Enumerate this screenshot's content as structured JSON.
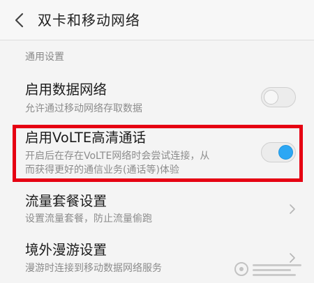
{
  "header": {
    "title": "双卡和移动网络",
    "back_icon": "chevron-left-icon"
  },
  "section": {
    "label": "通用设置"
  },
  "items": [
    {
      "title": "启用数据网络",
      "subtitle": "允许通过移动网络存取数据",
      "control": "toggle",
      "enabled": false
    },
    {
      "title": "启用VoLTE高清通话",
      "subtitle_line1": "开启后在存在VoLTE网络时会尝试连接，从",
      "subtitle_line2": "而获得更好的通信业务(通话等)体验",
      "control": "toggle",
      "enabled": true,
      "highlighted": true
    },
    {
      "title": "流量套餐设置",
      "subtitle": "设置流量套餐，防止流量偷跑",
      "control": "chevron-right-icon"
    },
    {
      "title": "境外漫游设置",
      "subtitle": "漫游时连接到移动数据网络服务",
      "control": "chevron-right-icon"
    }
  ],
  "colors": {
    "accent": "#2ca7f4",
    "highlight_border": "#e60012",
    "background": "#f4f4f4"
  },
  "watermark": {
    "icon": "baidu-jingyan-watermark"
  }
}
